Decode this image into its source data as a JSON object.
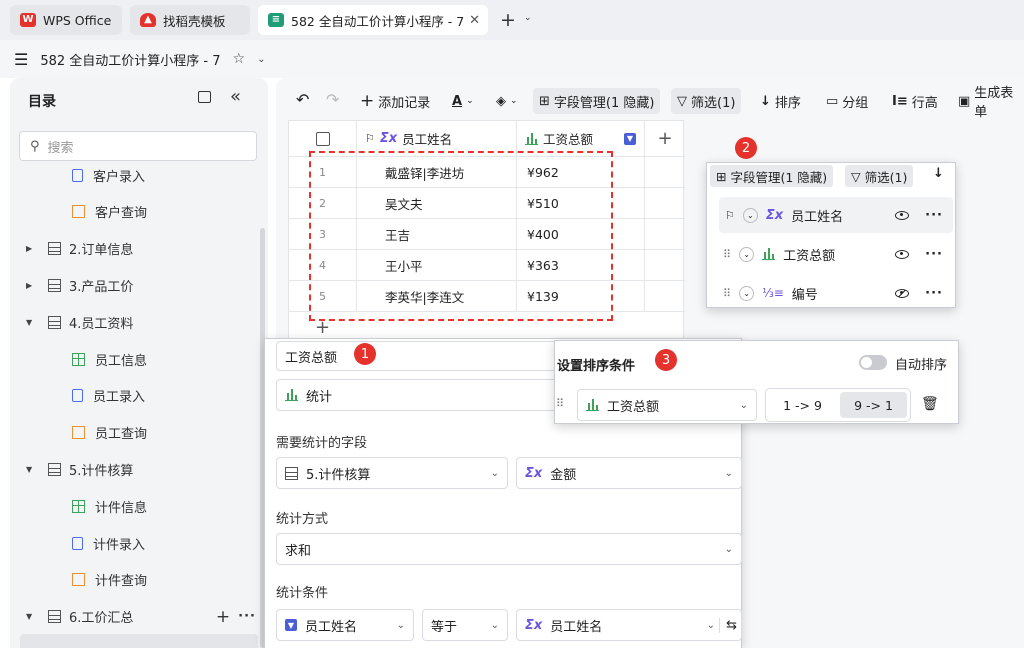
{
  "tabs": [
    {
      "label": "WPS Office",
      "active": false
    },
    {
      "label": "找稻壳模板",
      "active": false
    },
    {
      "label": "582 全自动工价计算小程序 - 7",
      "active": true
    }
  ],
  "doc": {
    "title": "582 全自动工价计算小程序 - 7"
  },
  "sidebar": {
    "title": "目录",
    "search_placeholder": "搜索",
    "items": [
      {
        "label": "客户录入",
        "type": "form",
        "level": 2
      },
      {
        "label": "客户查询",
        "type": "query",
        "level": 2
      },
      {
        "label": "2.订单信息",
        "type": "table",
        "level": 1,
        "expanded": false
      },
      {
        "label": "3.产品工价",
        "type": "table",
        "level": 1,
        "expanded": false
      },
      {
        "label": "4.员工资料",
        "type": "table",
        "level": 1,
        "expanded": true
      },
      {
        "label": "员工信息",
        "type": "grid",
        "level": 2
      },
      {
        "label": "员工录入",
        "type": "form",
        "level": 2
      },
      {
        "label": "员工查询",
        "type": "query",
        "level": 2
      },
      {
        "label": "5.计件核算",
        "type": "table",
        "level": 1,
        "expanded": true
      },
      {
        "label": "计件信息",
        "type": "grid",
        "level": 2
      },
      {
        "label": "计件录入",
        "type": "form",
        "level": 2
      },
      {
        "label": "计件查询",
        "type": "query",
        "level": 2
      },
      {
        "label": "6.工价汇总",
        "type": "table",
        "level": 1,
        "expanded": true
      }
    ]
  },
  "toolbar": {
    "add_record": "添加记录",
    "field_mgmt": "字段管理(1 隐藏)",
    "filter": "筛选(1)",
    "sort": "排序",
    "group": "分组",
    "row_height": "行高",
    "gen_form": "生成表单"
  },
  "table": {
    "col_name": "员工姓名",
    "col_total": "工资总额",
    "rows": [
      {
        "no": "1",
        "name": "戴盛铎|李进坊",
        "total": "¥962"
      },
      {
        "no": "2",
        "name": "吴文夫",
        "total": "¥510"
      },
      {
        "no": "3",
        "name": "王吉",
        "total": "¥400"
      },
      {
        "no": "4",
        "name": "王小平",
        "total": "¥363"
      },
      {
        "no": "5",
        "name": "李英华|李连文",
        "total": "¥139"
      }
    ]
  },
  "field_panel": {
    "badge": "2",
    "field_mgmt": "字段管理(1 隐藏)",
    "filter": "筛选(1)",
    "fields": [
      {
        "label": "员工姓名",
        "visible": true
      },
      {
        "label": "工资总额",
        "visible": true
      },
      {
        "label": "编号",
        "visible": false
      }
    ]
  },
  "stat_panel": {
    "badge": "1",
    "field_name": "工资总额",
    "field_type": "统计",
    "stat_field_label": "需要统计的字段",
    "stat_table": "5.计件核算",
    "stat_column": "金额",
    "stat_method_label": "统计方式",
    "stat_method": "求和",
    "stat_cond_label": "统计条件",
    "cond_field": "员工姓名",
    "cond_op": "等于",
    "cond_value": "员工姓名"
  },
  "sort_panel": {
    "badge": "3",
    "title": "设置排序条件",
    "auto_sort": "自动排序",
    "field": "工资总额",
    "asc": "1 -> 9",
    "desc": "9 -> 1",
    "selected": "desc"
  },
  "colors": {
    "accent": "#1f9d78",
    "red": "#e5322d",
    "purple": "#6b55e0",
    "green": "#3ea35a"
  }
}
